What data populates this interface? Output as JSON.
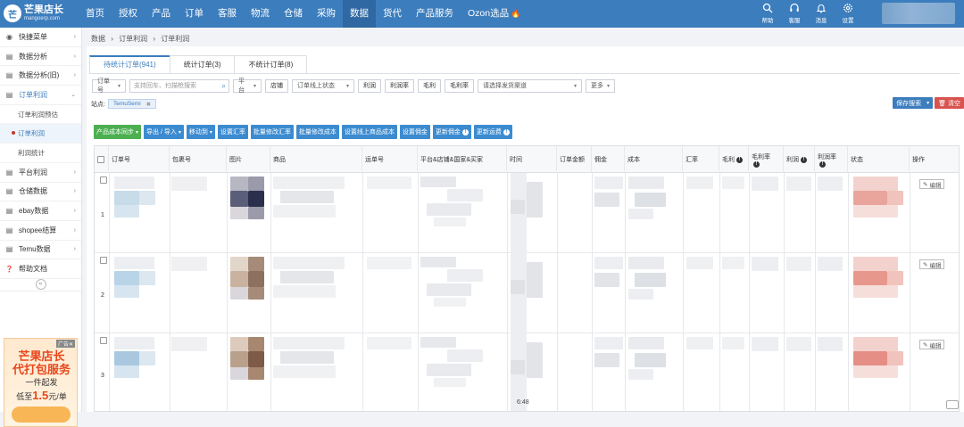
{
  "brand": {
    "logo_mark": "芒",
    "name": "芒果店长",
    "sub": "mangoerp.com"
  },
  "nav": [
    {
      "label": "首页"
    },
    {
      "label": "授权"
    },
    {
      "label": "产品"
    },
    {
      "label": "订单"
    },
    {
      "label": "客服"
    },
    {
      "label": "物流"
    },
    {
      "label": "仓储"
    },
    {
      "label": "采购"
    },
    {
      "label": "数据",
      "active": true
    },
    {
      "label": "货代"
    },
    {
      "label": "产品服务"
    },
    {
      "label": "Ozon选品"
    }
  ],
  "tools": [
    {
      "label": "帮助",
      "icon": "search-icon"
    },
    {
      "label": "客服",
      "icon": "headset-icon"
    },
    {
      "label": "消息",
      "icon": "bell-icon"
    },
    {
      "label": "设置",
      "icon": "gear-icon"
    }
  ],
  "sidebar": {
    "items": [
      {
        "label": "快捷菜单",
        "icon": "compass-icon"
      },
      {
        "label": "数据分析",
        "icon": "list-icon"
      },
      {
        "label": "数据分析(旧)",
        "icon": "list-icon"
      },
      {
        "label": "订单利润",
        "icon": "list-icon",
        "open": true
      },
      {
        "label": "订单利润预估",
        "sub": true
      },
      {
        "label": "订单利润",
        "sub": true,
        "active": true
      },
      {
        "label": "利润统计",
        "sub": true
      },
      {
        "label": "平台利润",
        "icon": "list-icon"
      },
      {
        "label": "仓储数据",
        "icon": "list-icon"
      },
      {
        "label": "ebay数据",
        "icon": "list-icon"
      },
      {
        "label": "shopee结算",
        "icon": "list-icon"
      },
      {
        "label": "Temu数据",
        "icon": "list-icon"
      },
      {
        "label": "帮助文档",
        "icon": "question-icon"
      }
    ],
    "collapse": "«"
  },
  "ad": {
    "badge": "广告✕",
    "line1": "芒果店长",
    "line2": "代打包服务",
    "line3": "一件起发",
    "price_pre": "低至",
    "price": "1.5",
    "price_post": "元/单"
  },
  "breadcrumb": [
    "数据",
    "›",
    "订单利润",
    "›",
    "订单利润"
  ],
  "tabs": [
    {
      "label": "待统计订单(941)",
      "active": true
    },
    {
      "label": "统计订单(3)"
    },
    {
      "label": "不统计订单(8)"
    }
  ],
  "filters": {
    "order_no": "订单号",
    "search_placeholder": "支持回车、扫描枪搜索",
    "platform": "平台",
    "store": "店铺",
    "online_status": "订单线上状态",
    "buttons": [
      "利润",
      "利润率",
      "毛利",
      "毛利率"
    ],
    "warehouse_placeholder": "请选择发货渠道",
    "more": "更多"
  },
  "site": {
    "label": "站点:",
    "tag": "TemuSemi",
    "tag_close": "✖"
  },
  "save_search": "保存搜索",
  "clear": "清空",
  "actions": [
    {
      "label": "产品成本同步",
      "dropdown": true,
      "green": true
    },
    {
      "label": "导出 / 导入",
      "dropdown": true
    },
    {
      "label": "移动到",
      "dropdown": true
    },
    {
      "label": "设置汇率"
    },
    {
      "label": "批量修改汇率"
    },
    {
      "label": "批量修改成本"
    },
    {
      "label": "设置线上商品成本"
    },
    {
      "label": "设置佣金"
    },
    {
      "label": "更新佣金",
      "info": true
    },
    {
      "label": "更新运费",
      "info": true
    }
  ],
  "table": {
    "columns": [
      {
        "label": "订单号"
      },
      {
        "label": "包裹号"
      },
      {
        "label": "图片"
      },
      {
        "label": "商品"
      },
      {
        "label": "运单号"
      },
      {
        "label": "平台&店铺&国家&买家"
      },
      {
        "label": "时间"
      },
      {
        "label": "订单金额"
      },
      {
        "label": "佣金"
      },
      {
        "label": "成本"
      },
      {
        "label": "汇率"
      },
      {
        "label": "毛利",
        "info": true
      },
      {
        "label": "毛利率",
        "info": true
      },
      {
        "label": "利润",
        "info": true
      },
      {
        "label": "利润率",
        "info": true
      },
      {
        "label": "状态"
      },
      {
        "label": "操作"
      }
    ],
    "rows": [
      {
        "num": "1"
      },
      {
        "num": "2"
      },
      {
        "num": "3"
      }
    ],
    "edit_label": "编辑",
    "time_fragment": "6:48"
  }
}
